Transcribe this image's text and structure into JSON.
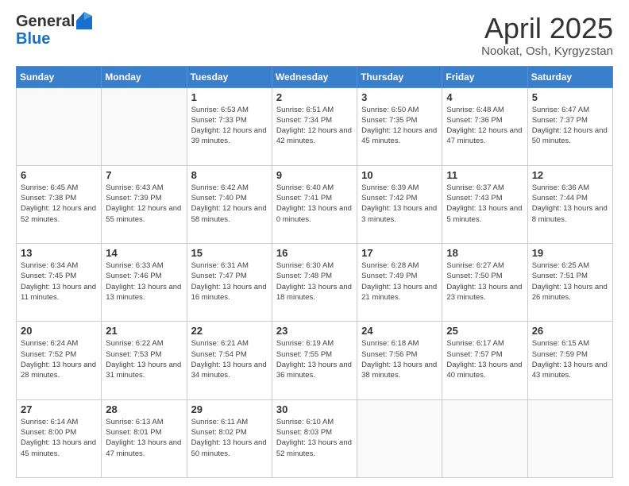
{
  "header": {
    "logo_general": "General",
    "logo_blue": "Blue",
    "title": "April 2025",
    "subtitle": "Nookat, Osh, Kyrgyzstan"
  },
  "days_of_week": [
    "Sunday",
    "Monday",
    "Tuesday",
    "Wednesday",
    "Thursday",
    "Friday",
    "Saturday"
  ],
  "weeks": [
    [
      {
        "day": "",
        "info": ""
      },
      {
        "day": "",
        "info": ""
      },
      {
        "day": "1",
        "info": "Sunrise: 6:53 AM\nSunset: 7:33 PM\nDaylight: 12 hours and 39 minutes."
      },
      {
        "day": "2",
        "info": "Sunrise: 6:51 AM\nSunset: 7:34 PM\nDaylight: 12 hours and 42 minutes."
      },
      {
        "day": "3",
        "info": "Sunrise: 6:50 AM\nSunset: 7:35 PM\nDaylight: 12 hours and 45 minutes."
      },
      {
        "day": "4",
        "info": "Sunrise: 6:48 AM\nSunset: 7:36 PM\nDaylight: 12 hours and 47 minutes."
      },
      {
        "day": "5",
        "info": "Sunrise: 6:47 AM\nSunset: 7:37 PM\nDaylight: 12 hours and 50 minutes."
      }
    ],
    [
      {
        "day": "6",
        "info": "Sunrise: 6:45 AM\nSunset: 7:38 PM\nDaylight: 12 hours and 52 minutes."
      },
      {
        "day": "7",
        "info": "Sunrise: 6:43 AM\nSunset: 7:39 PM\nDaylight: 12 hours and 55 minutes."
      },
      {
        "day": "8",
        "info": "Sunrise: 6:42 AM\nSunset: 7:40 PM\nDaylight: 12 hours and 58 minutes."
      },
      {
        "day": "9",
        "info": "Sunrise: 6:40 AM\nSunset: 7:41 PM\nDaylight: 13 hours and 0 minutes."
      },
      {
        "day": "10",
        "info": "Sunrise: 6:39 AM\nSunset: 7:42 PM\nDaylight: 13 hours and 3 minutes."
      },
      {
        "day": "11",
        "info": "Sunrise: 6:37 AM\nSunset: 7:43 PM\nDaylight: 13 hours and 5 minutes."
      },
      {
        "day": "12",
        "info": "Sunrise: 6:36 AM\nSunset: 7:44 PM\nDaylight: 13 hours and 8 minutes."
      }
    ],
    [
      {
        "day": "13",
        "info": "Sunrise: 6:34 AM\nSunset: 7:45 PM\nDaylight: 13 hours and 11 minutes."
      },
      {
        "day": "14",
        "info": "Sunrise: 6:33 AM\nSunset: 7:46 PM\nDaylight: 13 hours and 13 minutes."
      },
      {
        "day": "15",
        "info": "Sunrise: 6:31 AM\nSunset: 7:47 PM\nDaylight: 13 hours and 16 minutes."
      },
      {
        "day": "16",
        "info": "Sunrise: 6:30 AM\nSunset: 7:48 PM\nDaylight: 13 hours and 18 minutes."
      },
      {
        "day": "17",
        "info": "Sunrise: 6:28 AM\nSunset: 7:49 PM\nDaylight: 13 hours and 21 minutes."
      },
      {
        "day": "18",
        "info": "Sunrise: 6:27 AM\nSunset: 7:50 PM\nDaylight: 13 hours and 23 minutes."
      },
      {
        "day": "19",
        "info": "Sunrise: 6:25 AM\nSunset: 7:51 PM\nDaylight: 13 hours and 26 minutes."
      }
    ],
    [
      {
        "day": "20",
        "info": "Sunrise: 6:24 AM\nSunset: 7:52 PM\nDaylight: 13 hours and 28 minutes."
      },
      {
        "day": "21",
        "info": "Sunrise: 6:22 AM\nSunset: 7:53 PM\nDaylight: 13 hours and 31 minutes."
      },
      {
        "day": "22",
        "info": "Sunrise: 6:21 AM\nSunset: 7:54 PM\nDaylight: 13 hours and 34 minutes."
      },
      {
        "day": "23",
        "info": "Sunrise: 6:19 AM\nSunset: 7:55 PM\nDaylight: 13 hours and 36 minutes."
      },
      {
        "day": "24",
        "info": "Sunrise: 6:18 AM\nSunset: 7:56 PM\nDaylight: 13 hours and 38 minutes."
      },
      {
        "day": "25",
        "info": "Sunrise: 6:17 AM\nSunset: 7:57 PM\nDaylight: 13 hours and 40 minutes."
      },
      {
        "day": "26",
        "info": "Sunrise: 6:15 AM\nSunset: 7:59 PM\nDaylight: 13 hours and 43 minutes."
      }
    ],
    [
      {
        "day": "27",
        "info": "Sunrise: 6:14 AM\nSunset: 8:00 PM\nDaylight: 13 hours and 45 minutes."
      },
      {
        "day": "28",
        "info": "Sunrise: 6:13 AM\nSunset: 8:01 PM\nDaylight: 13 hours and 47 minutes."
      },
      {
        "day": "29",
        "info": "Sunrise: 6:11 AM\nSunset: 8:02 PM\nDaylight: 13 hours and 50 minutes."
      },
      {
        "day": "30",
        "info": "Sunrise: 6:10 AM\nSunset: 8:03 PM\nDaylight: 13 hours and 52 minutes."
      },
      {
        "day": "",
        "info": ""
      },
      {
        "day": "",
        "info": ""
      },
      {
        "day": "",
        "info": ""
      }
    ]
  ]
}
